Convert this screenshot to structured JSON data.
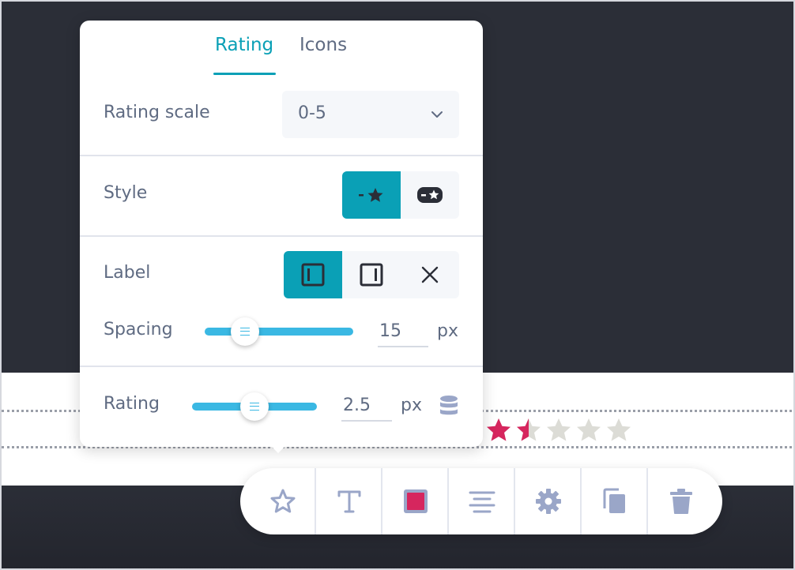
{
  "tabs": [
    {
      "label": "Rating",
      "active": true
    },
    {
      "label": "Icons",
      "active": false
    }
  ],
  "rating_scale": {
    "label": "Rating scale",
    "value": "0-5"
  },
  "style": {
    "label": "Style",
    "options": [
      "dash-star-icon",
      "badge-star-icon"
    ],
    "selected": 0
  },
  "label_position": {
    "label": "Label",
    "options": [
      "label-left-icon",
      "label-right-icon",
      "close-icon"
    ],
    "selected": 0
  },
  "spacing": {
    "label": "Spacing",
    "value": "15",
    "unit": "px",
    "fraction": 0.27
  },
  "rating": {
    "label": "Rating",
    "value": "2.5",
    "unit": "px",
    "fraction": 0.5
  },
  "stars": {
    "count": 5,
    "value": 1.5,
    "filled_color": "#d6265e",
    "empty_color": "#dcdcd6"
  },
  "toolbar": {
    "items": [
      "star-icon",
      "text-icon",
      "color-swatch",
      "align-icon",
      "gear-icon",
      "duplicate-icon",
      "trash-icon"
    ],
    "swatch_color": "#d6265e"
  },
  "colors": {
    "accent": "#0aa0b6",
    "slider": "#3ab8e3",
    "text": "#5f6b82",
    "icon": "#9aa6c8"
  }
}
